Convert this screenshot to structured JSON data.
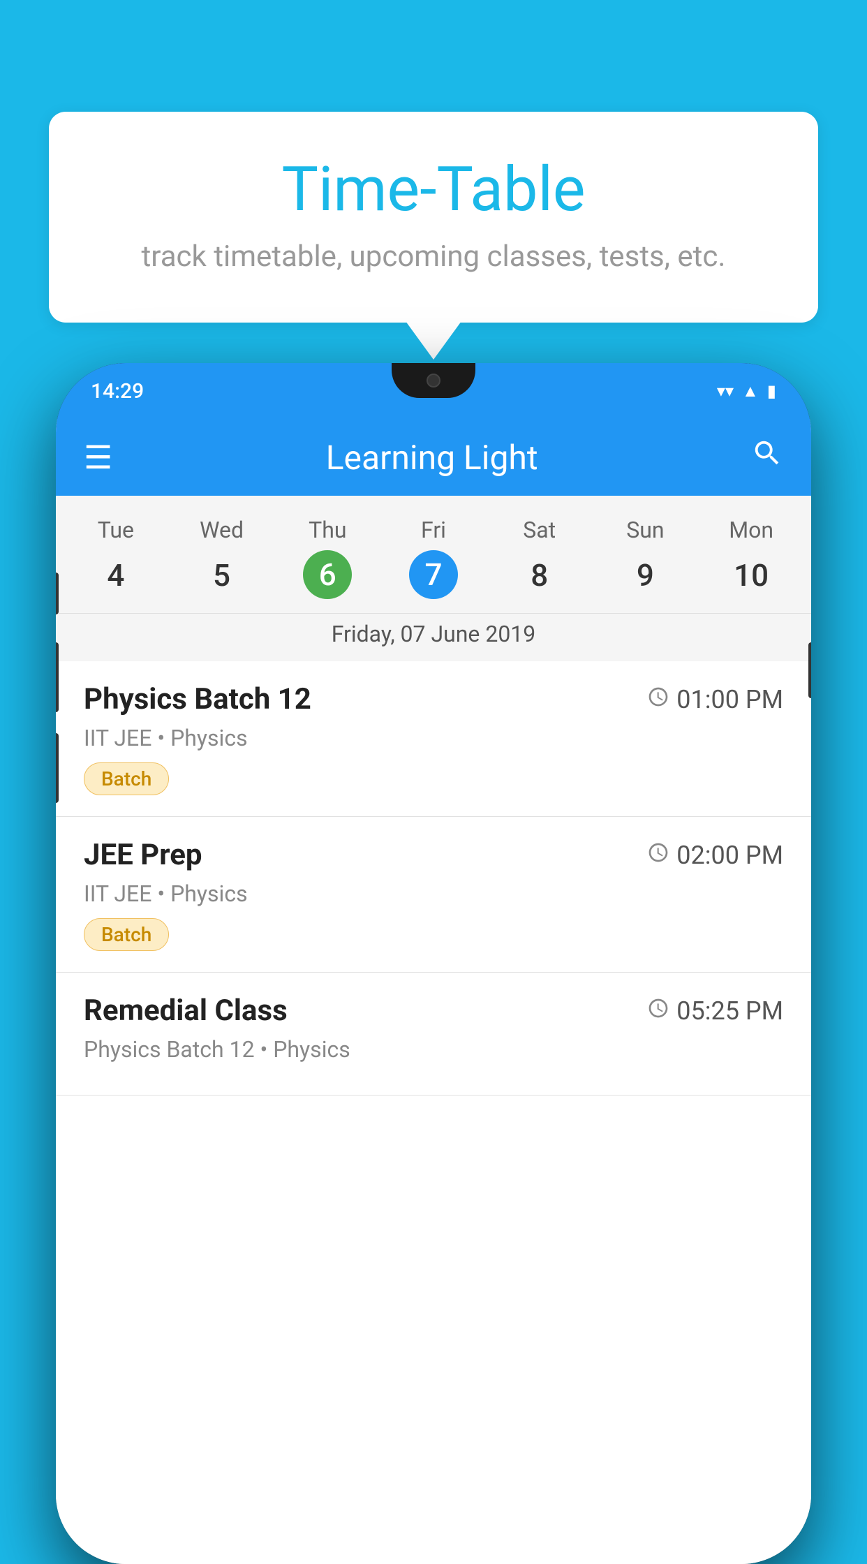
{
  "background_color": "#1BB8E8",
  "speech_bubble": {
    "title": "Time-Table",
    "subtitle": "track timetable, upcoming classes, tests, etc."
  },
  "phone": {
    "status_bar": {
      "time": "14:29"
    },
    "toolbar": {
      "title": "Learning Light",
      "menu_icon": "☰",
      "search_icon": "🔍"
    },
    "calendar": {
      "days": [
        "Tue",
        "Wed",
        "Thu",
        "Fri",
        "Sat",
        "Sun",
        "Mon"
      ],
      "dates": [
        "4",
        "5",
        "6",
        "7",
        "8",
        "9",
        "10"
      ],
      "today_index": 2,
      "selected_index": 3,
      "selected_label": "Friday, 07 June 2019"
    },
    "schedule": [
      {
        "title": "Physics Batch 12",
        "time": "01:00 PM",
        "subtitle": "IIT JEE • Physics",
        "badge": "Batch"
      },
      {
        "title": "JEE Prep",
        "time": "02:00 PM",
        "subtitle": "IIT JEE • Physics",
        "badge": "Batch"
      },
      {
        "title": "Remedial Class",
        "time": "05:25 PM",
        "subtitle": "Physics Batch 12 • Physics",
        "badge": ""
      }
    ]
  }
}
